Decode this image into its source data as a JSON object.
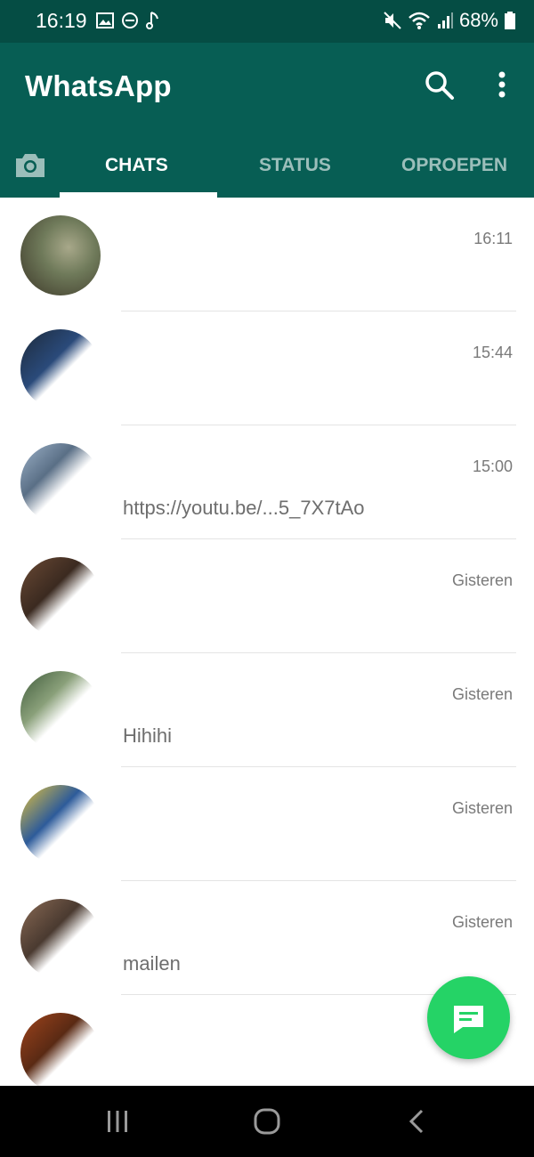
{
  "status_bar": {
    "time": "16:19",
    "battery": "68%",
    "icons": [
      "image-icon",
      "dnd-icon",
      "music-note-icon",
      "mute-icon",
      "wifi-icon",
      "signal-icon",
      "battery-icon"
    ]
  },
  "app_bar": {
    "title": "WhatsApp",
    "icons": [
      "search-icon",
      "more-vert-icon"
    ]
  },
  "tabs": [
    {
      "label": "CHATS",
      "active": true
    },
    {
      "label": "STATUS",
      "active": false
    },
    {
      "label": "OPROEPEN",
      "active": false
    }
  ],
  "chats": [
    {
      "time": "16:11",
      "preview": ""
    },
    {
      "time": "15:44",
      "preview": ""
    },
    {
      "time": "15:00",
      "preview": "https://youtu.be/...5_7X7tAo"
    },
    {
      "time": "Gisteren",
      "preview": ""
    },
    {
      "time": "Gisteren",
      "preview": "Hihihi"
    },
    {
      "time": "Gisteren",
      "preview": ""
    },
    {
      "time": "Gisteren",
      "preview": "mailen"
    },
    {
      "time": "",
      "preview": ""
    }
  ],
  "fab": {
    "icon": "new-chat-icon"
  },
  "colors": {
    "status_bar": "#054d44",
    "app_bar": "#075e54",
    "fab": "#25d366",
    "divider": "#e4e4e4"
  }
}
